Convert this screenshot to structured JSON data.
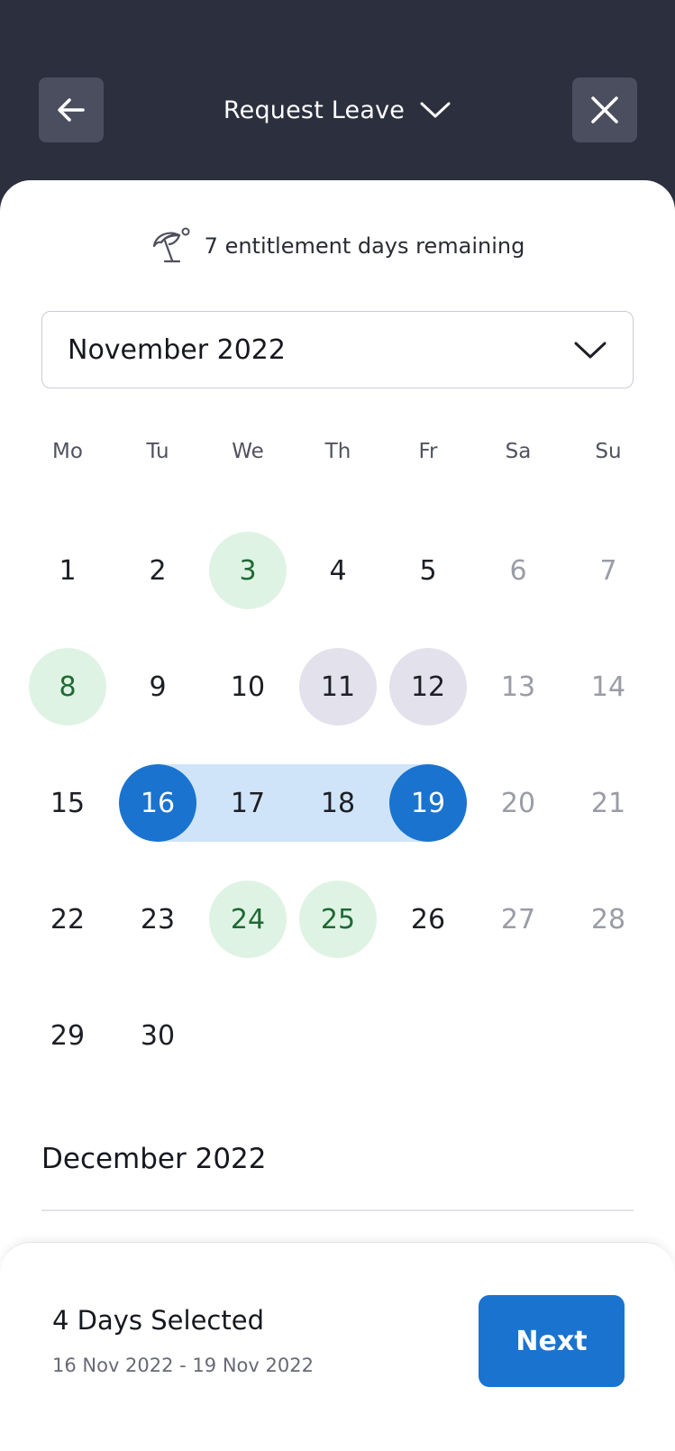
{
  "header": {
    "title": "Request Leave",
    "back_icon": "arrow-left-icon",
    "close_icon": "close-icon",
    "title_chevron_icon": "chevron-down-icon"
  },
  "entitlement": {
    "icon": "beach-umbrella-icon",
    "text": "7 entitlement days remaining"
  },
  "month_select": {
    "value": "November 2022",
    "icon": "chevron-down-icon"
  },
  "weekdays": [
    "Mo",
    "Tu",
    "We",
    "Th",
    "Fr",
    "Sa",
    "Su"
  ],
  "calendar": {
    "weeks": [
      [
        {
          "d": "1",
          "s": ""
        },
        {
          "d": "2",
          "s": ""
        },
        {
          "d": "3",
          "s": "holiday"
        },
        {
          "d": "4",
          "s": ""
        },
        {
          "d": "5",
          "s": ""
        },
        {
          "d": "6",
          "s": "weekend"
        },
        {
          "d": "7",
          "s": "weekend"
        }
      ],
      [
        {
          "d": "8",
          "s": "holiday"
        },
        {
          "d": "9",
          "s": ""
        },
        {
          "d": "10",
          "s": ""
        },
        {
          "d": "11",
          "s": "booked"
        },
        {
          "d": "12",
          "s": "booked"
        },
        {
          "d": "13",
          "s": "weekend"
        },
        {
          "d": "14",
          "s": "weekend"
        }
      ],
      [
        {
          "d": "15",
          "s": ""
        },
        {
          "d": "16",
          "s": "sel-end"
        },
        {
          "d": "17",
          "s": "in-range"
        },
        {
          "d": "18",
          "s": "in-range"
        },
        {
          "d": "19",
          "s": "sel-end"
        },
        {
          "d": "20",
          "s": "weekend"
        },
        {
          "d": "21",
          "s": "weekend"
        }
      ],
      [
        {
          "d": "22",
          "s": ""
        },
        {
          "d": "23",
          "s": ""
        },
        {
          "d": "24",
          "s": "holiday"
        },
        {
          "d": "25",
          "s": "holiday"
        },
        {
          "d": "26",
          "s": ""
        },
        {
          "d": "27",
          "s": "weekend"
        },
        {
          "d": "28",
          "s": "weekend"
        }
      ],
      [
        {
          "d": "29",
          "s": ""
        },
        {
          "d": "30",
          "s": ""
        }
      ]
    ]
  },
  "next_month_label": "December 2022",
  "footer": {
    "selected_count": "4 Days Selected",
    "selected_range": "16 Nov 2022 - 19 Nov 2022",
    "next_label": "Next"
  },
  "colors": {
    "header_bg": "#2c2f3e",
    "accent": "#1a73cf",
    "range_bg": "#cfe4f8",
    "holiday_bg": "#dff3e4",
    "booked_bg": "#e2e1ec"
  }
}
